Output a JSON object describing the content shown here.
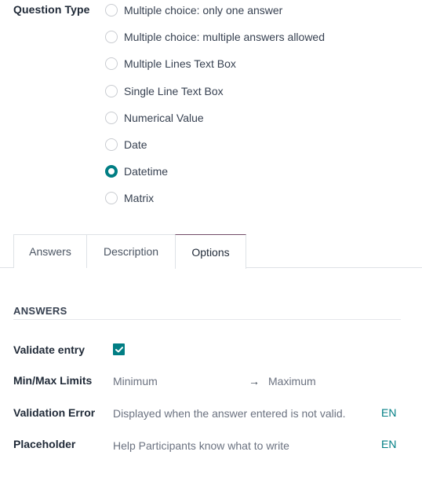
{
  "question_type": {
    "label": "Question Type",
    "options": [
      {
        "label": "Multiple choice: only one answer",
        "checked": false
      },
      {
        "label": "Multiple choice: multiple answers allowed",
        "checked": false
      },
      {
        "label": "Multiple Lines Text Box",
        "checked": false
      },
      {
        "label": "Single Line Text Box",
        "checked": false
      },
      {
        "label": "Numerical Value",
        "checked": false
      },
      {
        "label": "Date",
        "checked": false
      },
      {
        "label": "Datetime",
        "checked": true
      },
      {
        "label": "Matrix",
        "checked": false
      }
    ]
  },
  "tabs": [
    {
      "label": "Answers",
      "active": false
    },
    {
      "label": "Description",
      "active": false
    },
    {
      "label": "Options",
      "active": true
    }
  ],
  "options_section": {
    "title": "ANSWERS",
    "validate_entry": {
      "label": "Validate entry",
      "checked": true
    },
    "min_max": {
      "label": "Min/Max Limits",
      "min_placeholder": "Minimum",
      "arrow": "→",
      "max_placeholder": "Maximum"
    },
    "validation_error": {
      "label": "Validation Error",
      "placeholder": "Displayed when the answer entered is not valid.",
      "lang": "EN"
    },
    "placeholder": {
      "label": "Placeholder",
      "placeholder": "Help Participants know what to write",
      "lang": "EN"
    }
  },
  "colors": {
    "accent": "#017e84",
    "tab_active_border": "#714b67"
  }
}
